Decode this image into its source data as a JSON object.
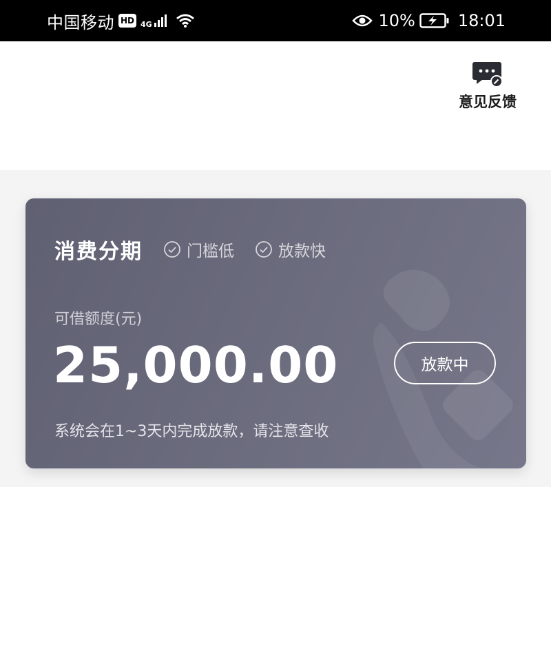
{
  "status_bar": {
    "carrier": "中国移动",
    "hd_label": "HD",
    "network_type": "4G",
    "battery_percent": "10%",
    "time": "18:01",
    "icons": [
      "signal-icon",
      "wifi-icon",
      "eye-icon",
      "battery-charging-icon"
    ]
  },
  "header": {
    "feedback_label": "意见反馈",
    "feedback_icon": "feedback-chat-icon"
  },
  "card": {
    "title": "消费分期",
    "tags": [
      "门槛低",
      "放款快"
    ],
    "tag_icon": "check-circle-icon",
    "credit_label": "可借额度(元)",
    "credit_amount": "25,000.00",
    "status_button": "放款中",
    "note": "系统会在1~3天内完成放款，请注意查收"
  },
  "colors": {
    "card_gradient_start": "#5f6072",
    "card_gradient_end": "#76778a",
    "page_band": "#f4f4f5"
  }
}
